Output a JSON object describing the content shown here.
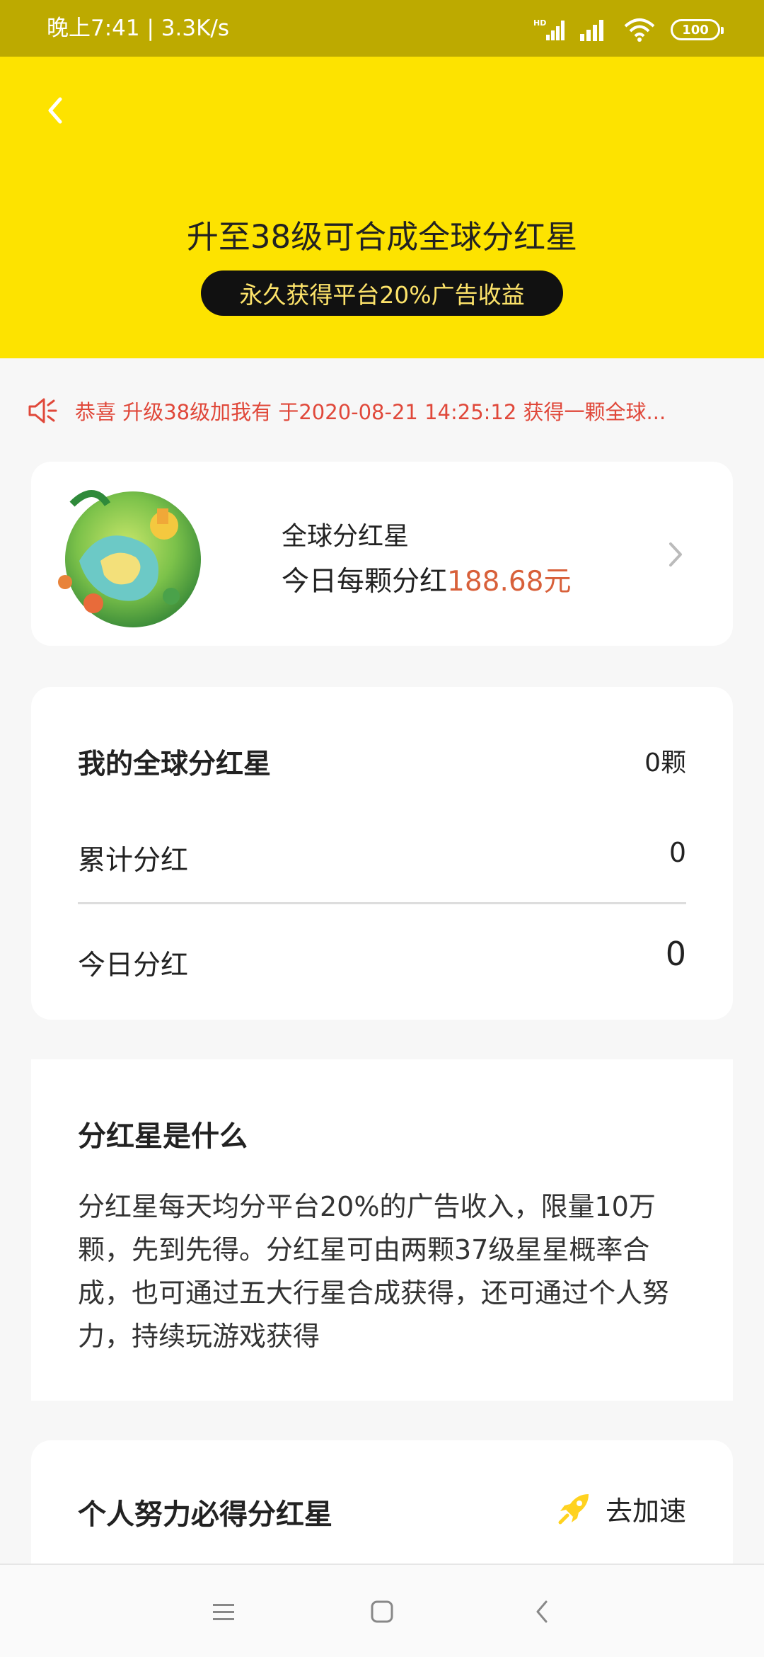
{
  "status_bar": {
    "time_speed": "晚上7:41 | 3.3K/s",
    "battery": "100",
    "icons": [
      "hd-signal-icon",
      "signal-icon",
      "wifi-icon",
      "battery-icon"
    ]
  },
  "header": {
    "back_icon": "chevron-left-icon",
    "title": "升至38级可合成全球分红星",
    "subtitle": "永久获得平台20%广告收益",
    "bg_color": "#fde300"
  },
  "notice": {
    "icon": "speaker-icon",
    "text": "恭喜 升级38级加我有 于2020-08-21 14:25:12 获得一颗全球...",
    "color": "#e0483a"
  },
  "planet_card": {
    "image": "planet-illustration",
    "name": "全球分红星",
    "dividend_label": "今日每颗分红",
    "dividend_amount": "188.68元",
    "amount_color": "#d8603a"
  },
  "stats_card": {
    "title": "我的全球分红星",
    "count": "0颗",
    "cumulative_label": "累计分红",
    "cumulative_value": "0",
    "today_label": "今日分红",
    "today_value": "0"
  },
  "info_card": {
    "title": "分红星是什么",
    "body": "分红星每天均分平台20%的广告收入，限量10万颗，先到先得。分红星可由两颗37级星星概率合成，也可通过五大行星合成获得，还可通过个人努力，持续玩游戏获得"
  },
  "effort_card": {
    "title": "个人努力必得分红星",
    "button_icon": "rocket-icon",
    "button_label": "去加速"
  },
  "nav_bar": {
    "items": [
      "menu-icon",
      "home-square-icon",
      "back-triangle-icon"
    ]
  }
}
